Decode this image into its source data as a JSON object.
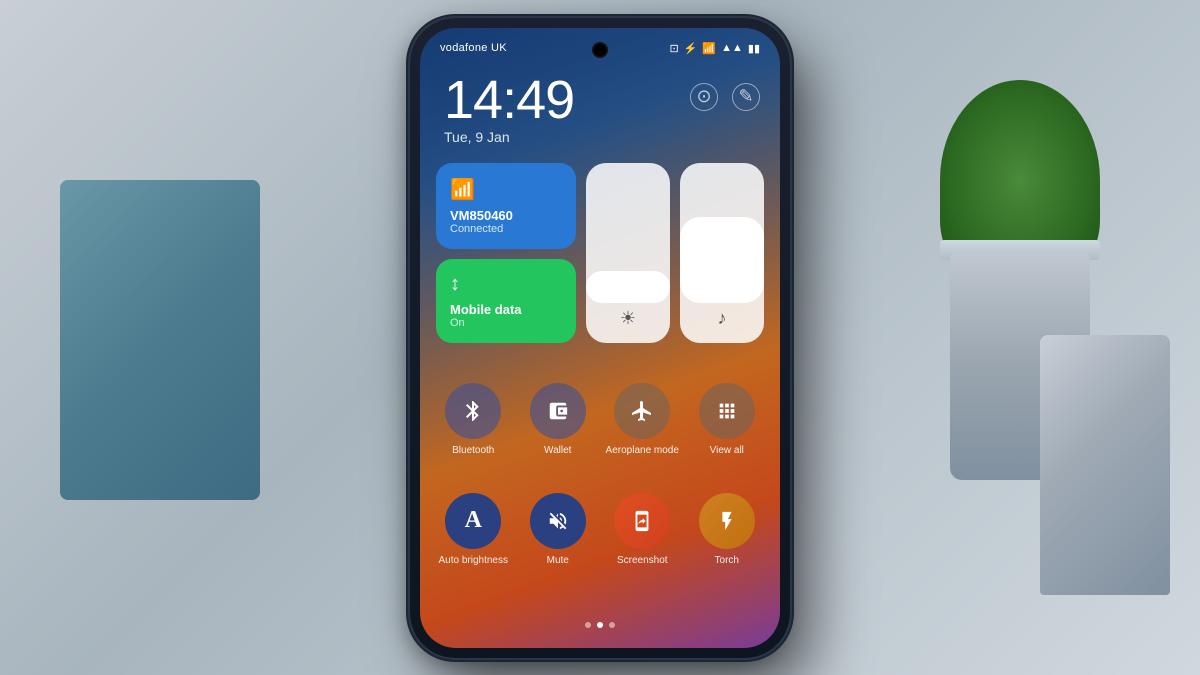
{
  "scene": {
    "background": "#b0b8c0"
  },
  "phone": {
    "status_bar": {
      "carrier": "vodafone UK",
      "icons": [
        "nfc-icon",
        "bluetooth-icon",
        "signal-icon",
        "wifi-icon",
        "battery-icon"
      ]
    },
    "time": "14:49",
    "date": "Tue, 9 Jan",
    "time_action_icons": [
      "brightness-icon",
      "edit-icon"
    ],
    "tiles": {
      "wifi": {
        "name": "VM850460",
        "status": "Connected"
      },
      "mobile": {
        "name": "Mobile data",
        "status": "On"
      },
      "brightness_label": "☀",
      "volume_label": "♪"
    },
    "quick_buttons_row1": [
      {
        "id": "bluetooth",
        "label": "Bluetooth",
        "icon": "⚡",
        "unicode": "𝗕"
      },
      {
        "id": "wallet",
        "label": "Wallet",
        "icon": "▬"
      },
      {
        "id": "aeroplane",
        "label": "Aeroplane mode",
        "icon": "✈"
      },
      {
        "id": "viewall",
        "label": "View all",
        "icon": "⊞"
      }
    ],
    "quick_buttons_row2": [
      {
        "id": "auto-brightness",
        "label": "Auto brightness",
        "icon": "A"
      },
      {
        "id": "mute",
        "label": "Mute",
        "icon": "🔕"
      },
      {
        "id": "screenshot",
        "label": "Screenshot",
        "icon": "⊠"
      },
      {
        "id": "torch",
        "label": "Torch",
        "icon": "🔦"
      }
    ],
    "pagination_dots": [
      {
        "active": false
      },
      {
        "active": true
      },
      {
        "active": false
      }
    ]
  }
}
